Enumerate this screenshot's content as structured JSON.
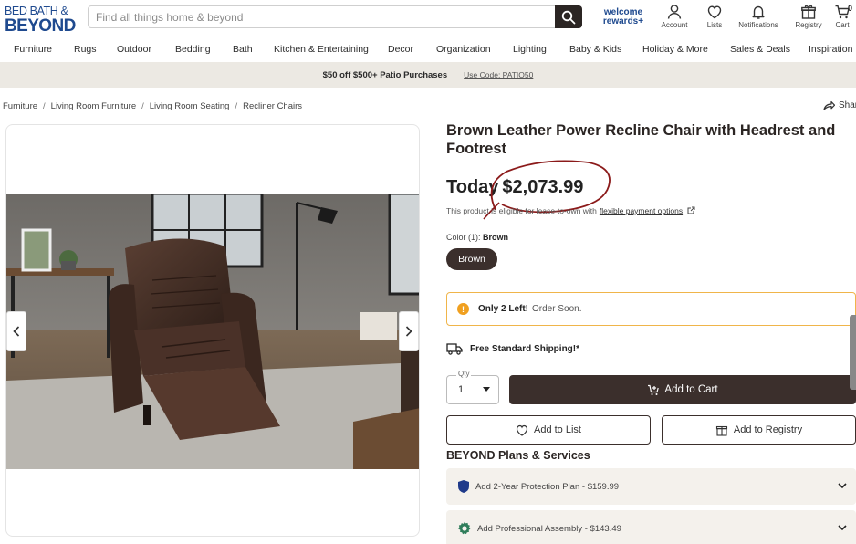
{
  "brand": {
    "line1": "BED BATH &",
    "line2": "BEYOND"
  },
  "search": {
    "placeholder": "Find all things home & beyond"
  },
  "header": {
    "welcome": "welcome rewards+",
    "icons": [
      {
        "label": "Account",
        "icon": "person-icon"
      },
      {
        "label": "Lists",
        "icon": "heart-icon"
      },
      {
        "label": "Notifications",
        "icon": "bell-icon"
      },
      {
        "label": "Registry",
        "icon": "gift-icon"
      },
      {
        "label": "Cart",
        "icon": "cart-icon"
      }
    ],
    "cart_count": "0"
  },
  "nav": {
    "items": [
      "Furniture",
      "Rugs",
      "Outdoor",
      "Bedding",
      "Bath",
      "Kitchen & Entertaining",
      "Decor",
      "Organization",
      "Lighting",
      "Baby & Kids",
      "Holiday & More",
      "Sales & Deals",
      "Inspiration"
    ]
  },
  "promo": {
    "text": "$50 off $500+ Patio Purchases",
    "code": "Use Code: PATIO50"
  },
  "breadcrumb": [
    "Furniture",
    "Living Room Furniture",
    "Living Room Seating",
    "Recliner Chairs"
  ],
  "share_label": "Shar",
  "product": {
    "title": "Brown Leather Power Recline Chair with Headrest and Footrest",
    "price_prefix": "Today",
    "price": "$2,073.99",
    "lease_text": "This product is eligible for lease-to-own with",
    "lease_link": "flexible payment options",
    "color_label": "Color (1):",
    "color_value": "Brown",
    "swatch_label": "Brown",
    "stock_hot": "Only 2 Left!",
    "stock_note": "Order Soon.",
    "shipping": "Free Standard Shipping!*",
    "qty_label": "Qty",
    "qty_value": "1",
    "add_to_cart": "Add to Cart",
    "add_to_list": "Add to List",
    "add_to_registry": "Add to Registry"
  },
  "plans": {
    "title": "BEYOND Plans & Services",
    "items": [
      {
        "label": "Add 2-Year Protection Plan - $159.99",
        "icon": "shield-icon"
      },
      {
        "label": "Add Professional Assembly - $143.49",
        "icon": "gear-icon"
      }
    ]
  },
  "colors": {
    "primary_dark": "#3b2f2c",
    "brand_blue": "#1f4a8f",
    "promo_bg": "#ece9e3",
    "alert_border": "#f0b54a",
    "annotation": "#8b1a1a"
  }
}
